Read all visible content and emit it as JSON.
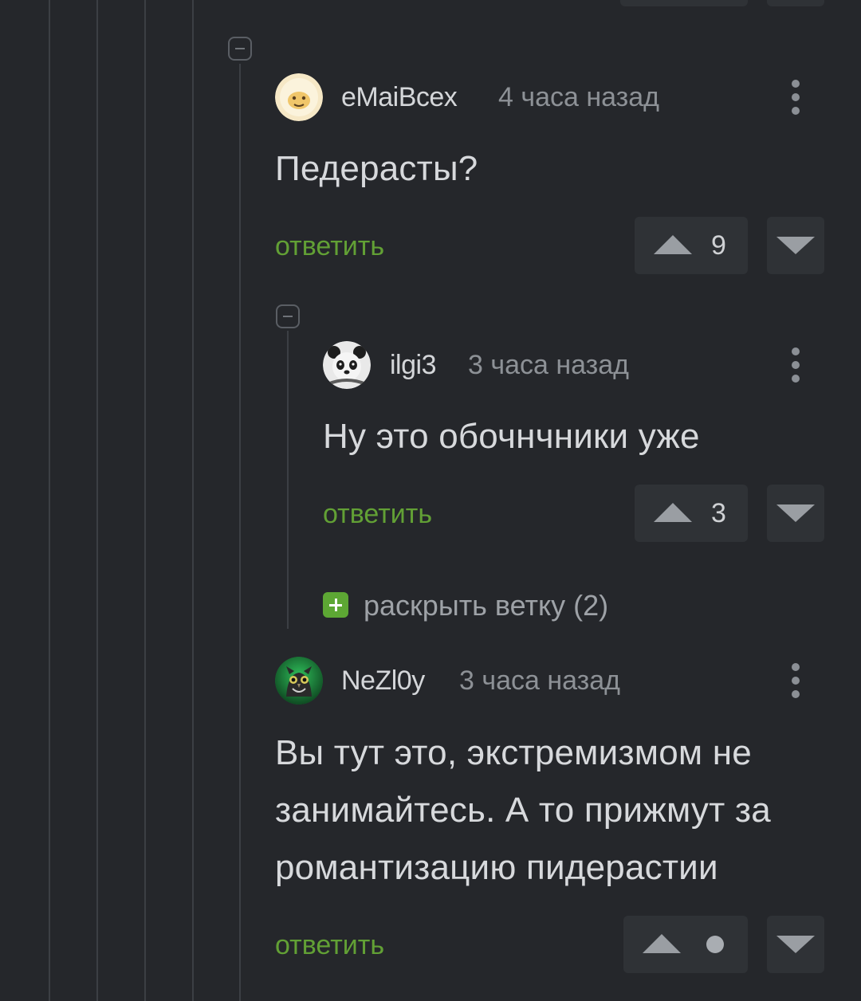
{
  "comments": [
    {
      "username": "eMaiBcex",
      "time": "4 часа назад",
      "text": "Педерасты?",
      "reply_label": "ответить",
      "votes": "9"
    },
    {
      "username": "ilgi3",
      "time": "3 часа назад",
      "text": "Ну это обочнчники уже",
      "reply_label": "ответить",
      "votes": "3"
    },
    {
      "username": "NeZl0y",
      "time": "3 часа назад",
      "text_lines": [
        "Вы тут это, экстремизмом не",
        "занимайтесь. А то прижмут за",
        "романтизацию пидерастии"
      ],
      "reply_label": "ответить",
      "votes": ""
    }
  ],
  "expand_branch": {
    "label": "раскрыть ветку (2)"
  },
  "colors": {
    "background": "#25272b",
    "accent_green": "#62a035",
    "vote_box": "#2f3236"
  },
  "icons": [
    "collapse-thread-icon",
    "kebab-menu-icon",
    "upvote-icon",
    "downvote-icon",
    "expand-plus-icon"
  ]
}
